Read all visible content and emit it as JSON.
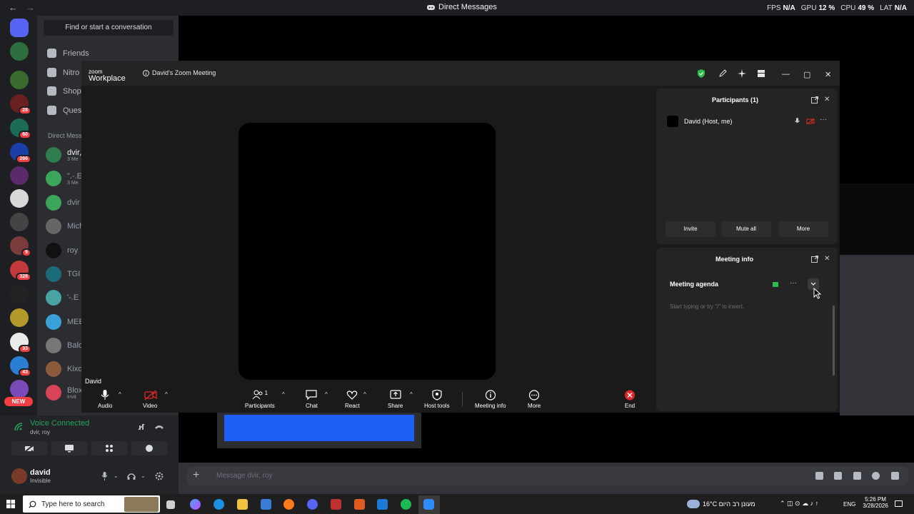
{
  "discord": {
    "window_title": "Direct Messages",
    "nav_back": "←",
    "nav_forward": "→",
    "perf": [
      {
        "key": "FPS",
        "val": "N/A"
      },
      {
        "key": "GPU",
        "val": "12 %"
      },
      {
        "key": "CPU",
        "val": "49 %"
      },
      {
        "key": "LAT",
        "val": "N/A"
      }
    ],
    "search_placeholder": "Find or start a conversation",
    "nav": [
      "Friends",
      "Nitro",
      "Shop",
      "Quest"
    ],
    "dm_header": "Direct Mess",
    "dms": [
      {
        "name": "dvir,",
        "sub": "3 Me"
      },
      {
        "name": "\".-.E",
        "sub": "3 Me"
      },
      {
        "name": "dvir"
      },
      {
        "name": "Mich"
      },
      {
        "name": "roy"
      },
      {
        "name": "TGI"
      },
      {
        "name": "'-.E"
      },
      {
        "name": "MEE"
      },
      {
        "name": "Balo"
      },
      {
        "name": "Kixo"
      },
      {
        "name": "Blox",
        "sub": "Invit"
      }
    ],
    "server_badges": [
      "28",
      "60",
      "266",
      "9",
      "328",
      "33",
      "43"
    ],
    "new_badge": "NEW",
    "voice_status": "Voice Connected",
    "voice_sub": "dvir, roy",
    "user_name": "david",
    "user_status": "Invisible",
    "message_placeholder": "Message dvir, roy",
    "colors": {
      "bg": "#313338",
      "sidebar": "#2b2d31",
      "rail": "#1e1f22",
      "green": "#23a55a",
      "red": "#f23f43"
    }
  },
  "zoom": {
    "logo_top": "zoom",
    "logo_bottom": "Workplace",
    "meeting_title": "David's Zoom Meeting",
    "name_tag": "David",
    "toolbar": {
      "audio": "Audio",
      "video": "Video",
      "participants": "Participants",
      "participants_count": "1",
      "chat": "Chat",
      "react": "React",
      "share": "Share",
      "host_tools": "Host tools",
      "meeting_info": "Meeting info",
      "more": "More",
      "end": "End"
    },
    "participants_panel": {
      "title": "Participants (1)",
      "participant": "David (Host, me)",
      "invite": "Invite",
      "mute_all": "Mute all",
      "more": "More"
    },
    "meeting_info_panel": {
      "title": "Meeting info",
      "agenda": "Meeting agenda",
      "placeholder": "Start typing or try \"/\" to insert."
    },
    "colors": {
      "end_red": "#e02828",
      "shield_green": "#2dbb4c"
    }
  },
  "taskbar": {
    "search_placeholder": "Type here to search",
    "weather": "16°C  מעונן רב היום",
    "lang": "ENG",
    "time": "5:26 PM",
    "date": "3/28/2026"
  }
}
